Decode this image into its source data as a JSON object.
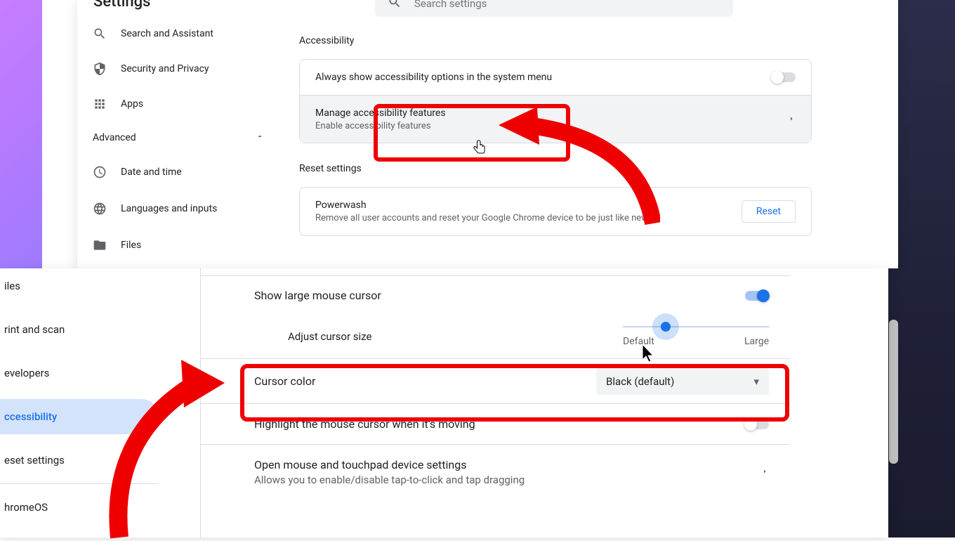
{
  "top": {
    "title": "Settings",
    "search_placeholder": "Search settings",
    "sidebar": {
      "items": [
        {
          "label": "Search and Assistant"
        },
        {
          "label": "Security and Privacy"
        },
        {
          "label": "Apps"
        }
      ],
      "advanced": "Advanced",
      "sub": [
        {
          "label": "Date and time"
        },
        {
          "label": "Languages and inputs"
        },
        {
          "label": "Files"
        }
      ]
    },
    "accessibility": {
      "heading": "Accessibility",
      "row1": "Always show accessibility options in the system menu",
      "row2_title": "Manage accessibility features",
      "row2_sub": "Enable accessibility features"
    },
    "reset": {
      "heading": "Reset settings",
      "title": "Powerwash",
      "sub": "Remove all user accounts and reset your Google Chrome device to be just like new.",
      "btn": "Reset"
    }
  },
  "bottom": {
    "sidebar": {
      "items": [
        {
          "label": "iles"
        },
        {
          "label": "rint and scan"
        },
        {
          "label": "evelopers"
        },
        {
          "label": "ccessibility"
        },
        {
          "label": "eset settings"
        },
        {
          "label": "hromeOS"
        }
      ]
    },
    "row_large": "Show large mouse cursor",
    "row_adjust": "Adjust cursor size",
    "slider_min": "Default",
    "slider_max": "Large",
    "row_color": "Cursor color",
    "color_value": "Black (default)",
    "row_highlight": "Highlight the mouse cursor when it's moving",
    "row_open_title": "Open mouse and touchpad device settings",
    "row_open_sub": "Allows you to enable/disable tap-to-click and tap dragging"
  }
}
